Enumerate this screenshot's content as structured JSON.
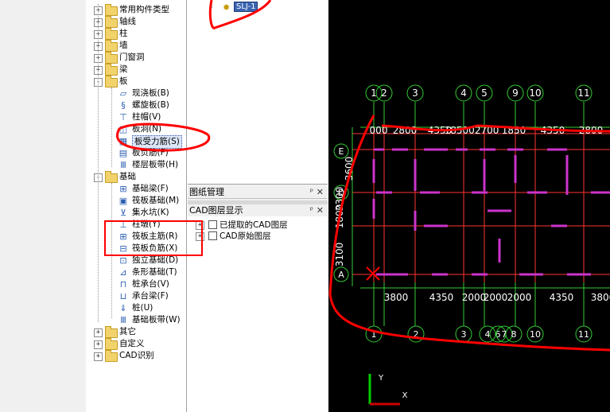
{
  "tree": {
    "top_level": [
      {
        "label": "常用构件类型"
      },
      {
        "label": "轴线"
      },
      {
        "label": "柱"
      },
      {
        "label": "墙"
      },
      {
        "label": "门窗洞"
      },
      {
        "label": "梁"
      },
      {
        "label": "板"
      }
    ],
    "board_children": [
      {
        "label": "现浇板(B)",
        "icon": "slab-icon"
      },
      {
        "label": "螺旋板(B)",
        "icon": "spiral-slab-icon"
      },
      {
        "label": "柱帽(V)",
        "icon": "column-cap-icon"
      },
      {
        "label": "板洞(N)",
        "icon": "slab-hole-icon"
      },
      {
        "label": "板受力筋(S)",
        "icon": "slab-rebar-icon"
      },
      {
        "label": "板负筋(F)",
        "icon": "negative-rebar-icon"
      },
      {
        "label": "楼层板带(H)",
        "icon": "floor-strip-icon"
      }
    ],
    "foundation": {
      "label": "基础"
    },
    "foundation_children": [
      {
        "label": "基础梁(F)",
        "icon": "foundation-beam-icon"
      },
      {
        "label": "筏板基础(M)",
        "icon": "raft-foundation-icon"
      },
      {
        "label": "集水坑(K)",
        "icon": "sump-icon"
      },
      {
        "label": "柱墩(Y)",
        "icon": "pier-icon"
      },
      {
        "label": "筏板主筋(R)",
        "icon": "raft-main-rebar-icon"
      },
      {
        "label": "筏板负筋(X)",
        "icon": "raft-negative-rebar-icon"
      },
      {
        "label": "独立基础(D)",
        "icon": "isolated-foundation-icon"
      },
      {
        "label": "条形基础(T)",
        "icon": "strip-foundation-icon"
      },
      {
        "label": "桩承台(V)",
        "icon": "pile-cap-icon"
      },
      {
        "label": "承台梁(F)",
        "icon": "cap-beam-icon"
      },
      {
        "label": "桩(U)",
        "icon": "pile-icon"
      },
      {
        "label": "基础板带(W)",
        "icon": "foundation-strip-icon"
      }
    ],
    "bottom_level": [
      {
        "label": "其它"
      },
      {
        "label": "自定义"
      },
      {
        "label": "CAD识别"
      }
    ]
  },
  "component_list": {
    "selected_item": "SLJ-1"
  },
  "drawing_manager": {
    "title": "图纸管理"
  },
  "cad_layers": {
    "title": "CAD图层显示",
    "items": [
      {
        "label": "已提取的CAD图层",
        "checked": false
      },
      {
        "label": "CAD原始图层",
        "checked": false
      }
    ]
  },
  "cad_view": {
    "top_axes": [
      "1",
      "2",
      "3",
      "4",
      "5",
      "9",
      "10",
      "11"
    ],
    "bottom_axes": [
      "1",
      "2",
      "3",
      "4",
      "6",
      "7",
      "8",
      "10",
      "11"
    ],
    "left_axes": [
      "E",
      "D",
      "A"
    ],
    "top_dims": [
      "000",
      "2800",
      "4350",
      "185002700",
      "1850",
      "4350",
      "2800"
    ],
    "bottom_dims": [
      "3800",
      "4350",
      "2000",
      "2000",
      "2000",
      "4350",
      "3800"
    ],
    "left_dims": [
      "3600",
      "2300",
      "1800",
      "3100"
    ],
    "ucs_y": "Y",
    "ucs_x": "X",
    "colors": {
      "grid": "#ff3333",
      "axis": "#33cc33",
      "text": "#ffffff",
      "wall": "#cc33cc",
      "annotation": "#ff0000"
    }
  }
}
